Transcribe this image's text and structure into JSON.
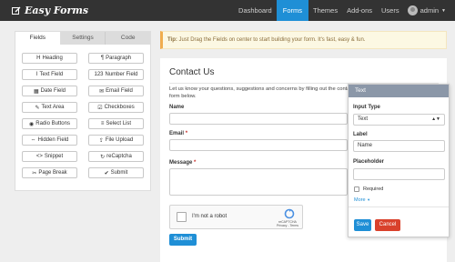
{
  "brand": {
    "name": "Easy Forms",
    "icon": "edit-icon"
  },
  "nav": {
    "items": [
      "Dashboard",
      "Forms",
      "Themes",
      "Add-ons",
      "Users"
    ],
    "active": "Forms",
    "user": "admin"
  },
  "left_panel": {
    "tabs": [
      "Fields",
      "Settings",
      "Code"
    ],
    "active_tab": "Fields",
    "fields": [
      {
        "icon": "H",
        "label": "Heading"
      },
      {
        "icon": "¶",
        "label": "Paragraph"
      },
      {
        "icon": "I",
        "label": "Text Field"
      },
      {
        "icon": "123",
        "label": "Number Field"
      },
      {
        "icon": "▦",
        "label": "Date Field"
      },
      {
        "icon": "✉",
        "label": "Email Field"
      },
      {
        "icon": "✎",
        "label": "Text Area"
      },
      {
        "icon": "☑",
        "label": "Checkboxes"
      },
      {
        "icon": "◉",
        "label": "Radio Buttons"
      },
      {
        "icon": "≡",
        "label": "Select List"
      },
      {
        "icon": "⇔",
        "label": "Hidden Field"
      },
      {
        "icon": "⇪",
        "label": "File Upload"
      },
      {
        "icon": "<>",
        "label": "Snippet"
      },
      {
        "icon": "↻",
        "label": "reCaptcha"
      },
      {
        "icon": "✂",
        "label": "Page Break"
      },
      {
        "icon": "✔",
        "label": "Submit"
      }
    ]
  },
  "tip": {
    "label": "Tip:",
    "text": " Just Drag the Fields on center to start building your form. It's fast, easy & fun."
  },
  "form": {
    "title": "Contact Us",
    "description": "Let us know your questions, suggestions and concerns by filling out the contact form below.",
    "fields": {
      "name_label": "Name",
      "email_label": "Email",
      "message_label": "Message",
      "required_mark": "*"
    },
    "recaptcha": {
      "text": "I'm not a robot",
      "brand": "reCAPTCHA",
      "links": "Privacy - Terms"
    },
    "submit_label": "Submit"
  },
  "popover": {
    "title": "Text",
    "input_type_label": "Input Type",
    "input_type_value": "Text",
    "label_label": "Label",
    "label_value": "Name",
    "placeholder_label": "Placeholder",
    "placeholder_value": "",
    "required_label": "Required",
    "more_label": "More",
    "save_label": "Save",
    "cancel_label": "Cancel"
  }
}
